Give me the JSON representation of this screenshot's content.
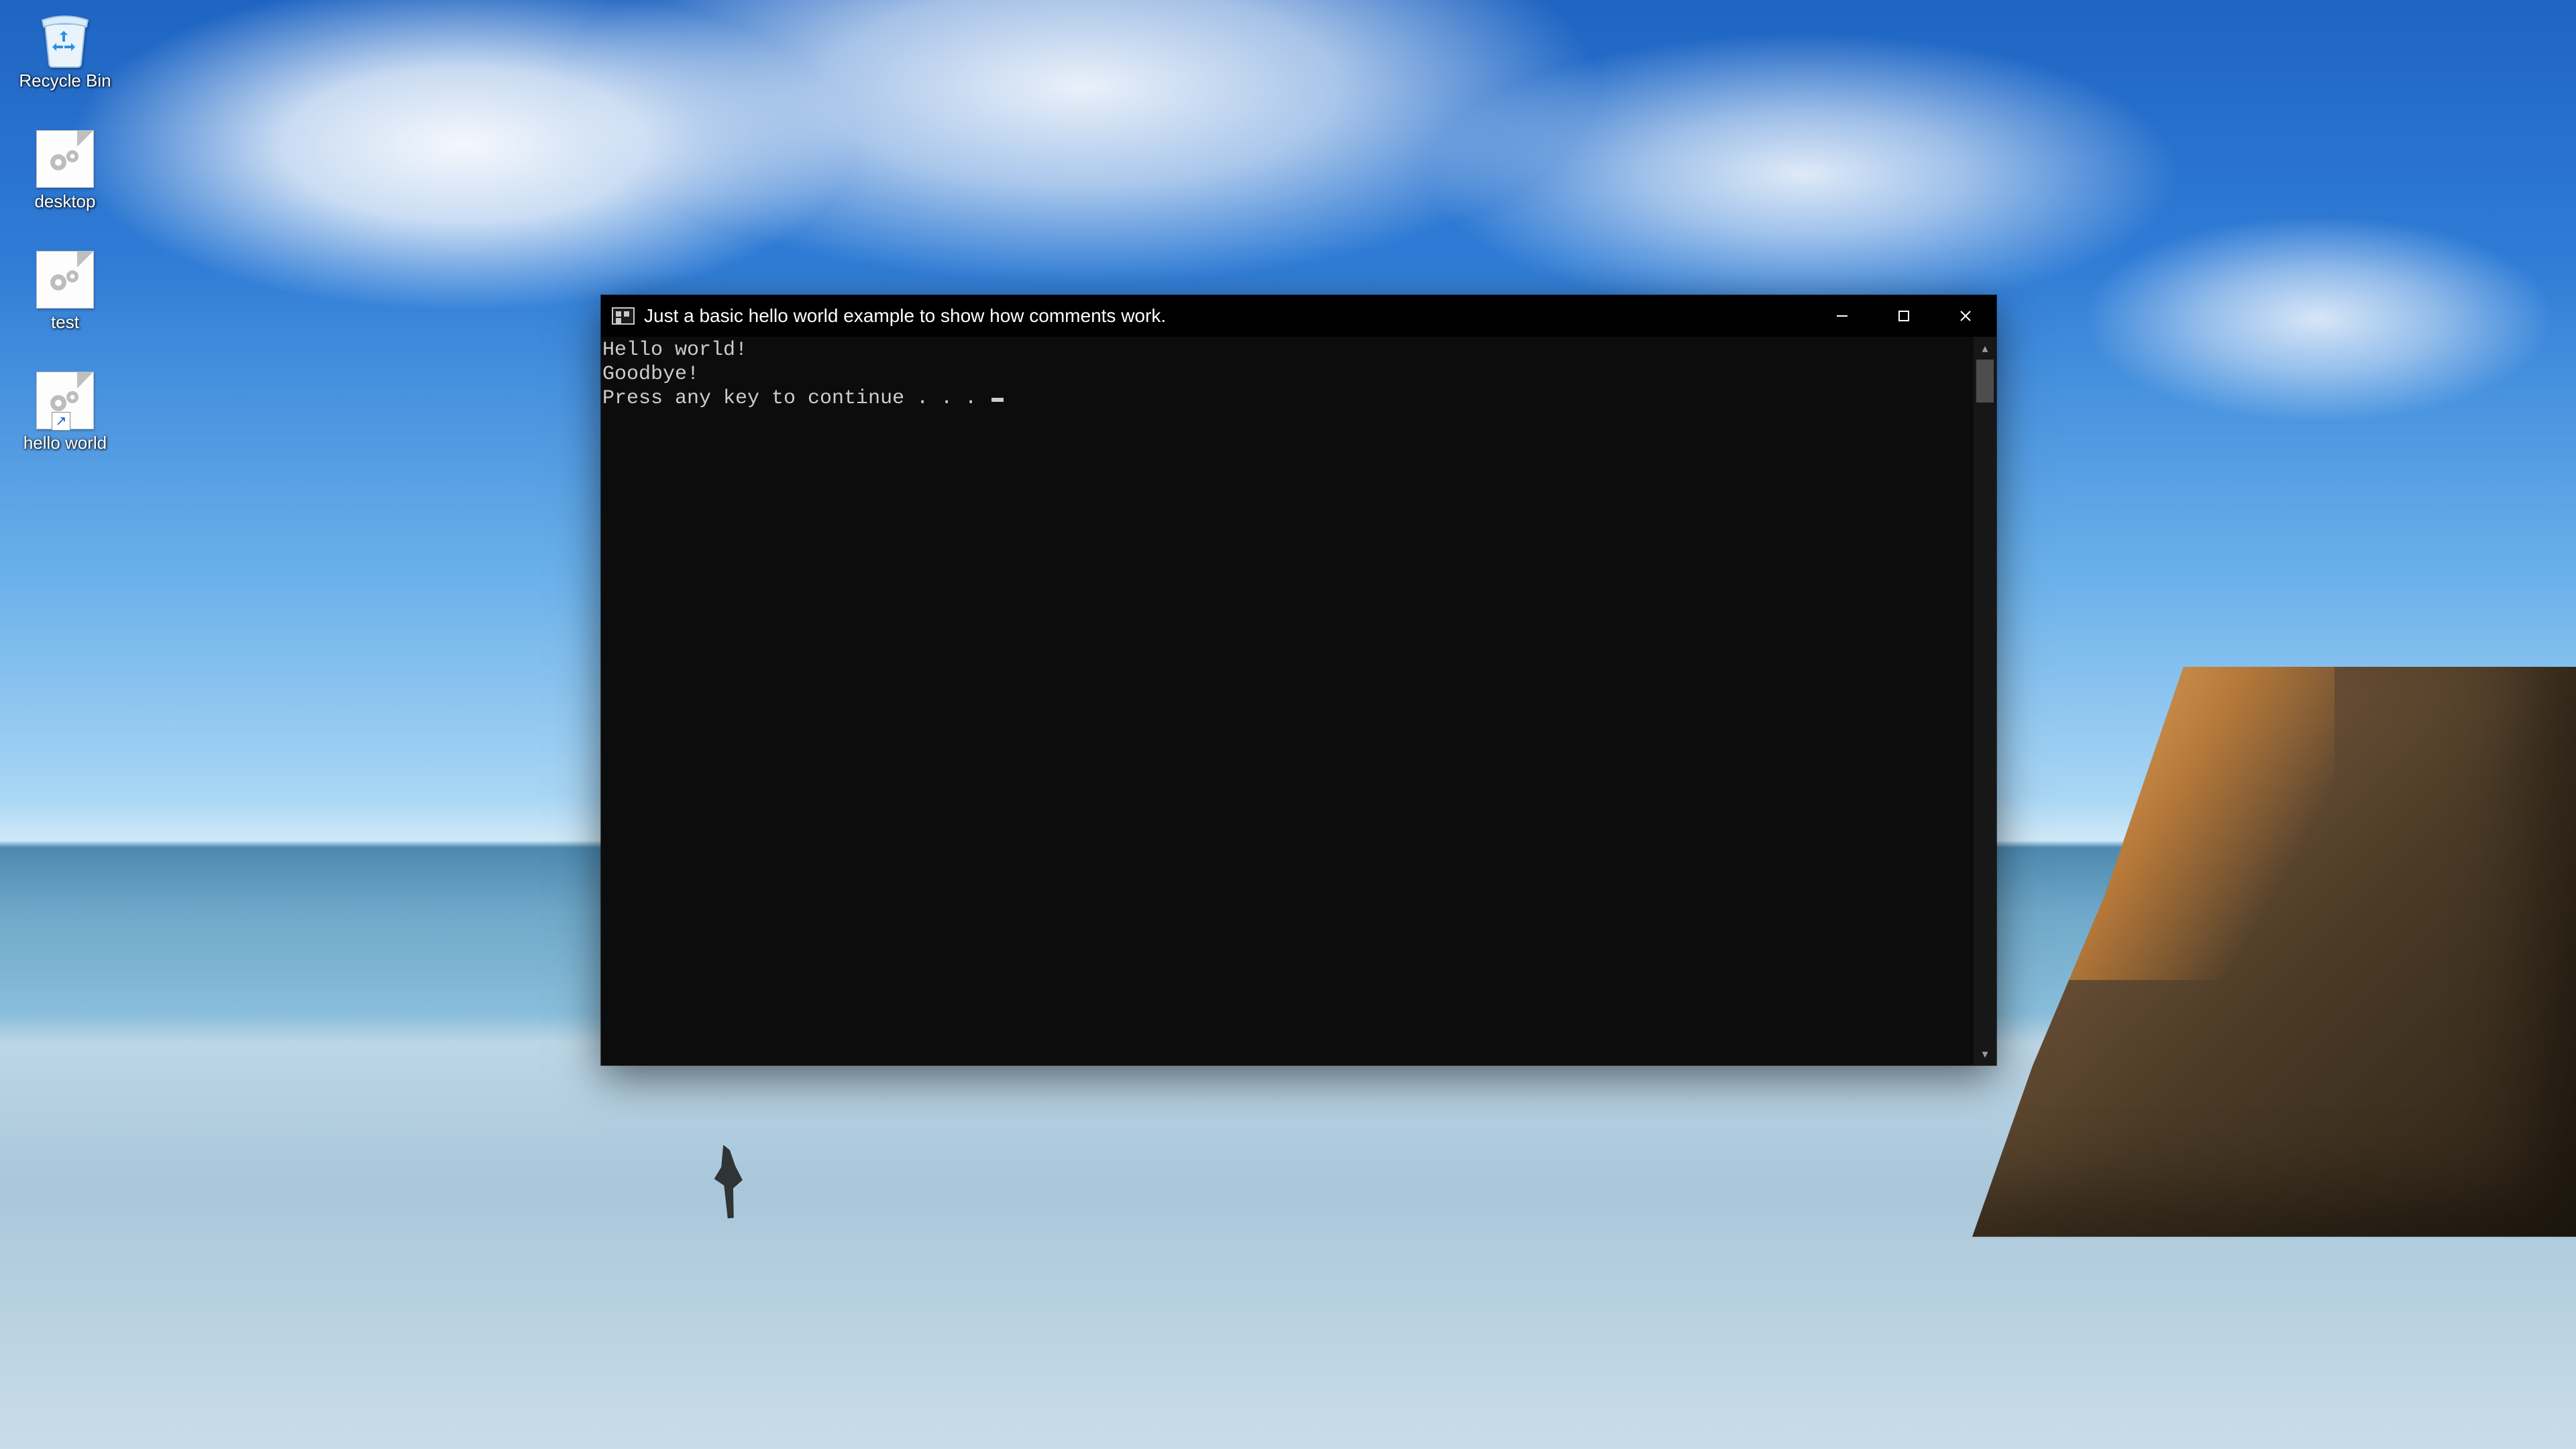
{
  "desktop": {
    "icons": [
      {
        "id": "recycle-bin",
        "label": "Recycle Bin"
      },
      {
        "id": "desktop-bat",
        "label": "desktop"
      },
      {
        "id": "test-bat",
        "label": "test"
      },
      {
        "id": "hello-bat",
        "label": "hello world"
      }
    ]
  },
  "window": {
    "title": "Just a basic hello world example to show how comments work.",
    "controls": {
      "minimize": "Minimize",
      "maximize": "Maximize",
      "close": "Close"
    },
    "output_lines": [
      "Hello world!",
      "Goodbye!",
      "Press any key to continue . . . "
    ]
  },
  "colors": {
    "console_bg": "#0c0c0c",
    "console_fg": "#cccccc",
    "titlebar_bg": "#000000",
    "close_hover": "#e81123"
  }
}
